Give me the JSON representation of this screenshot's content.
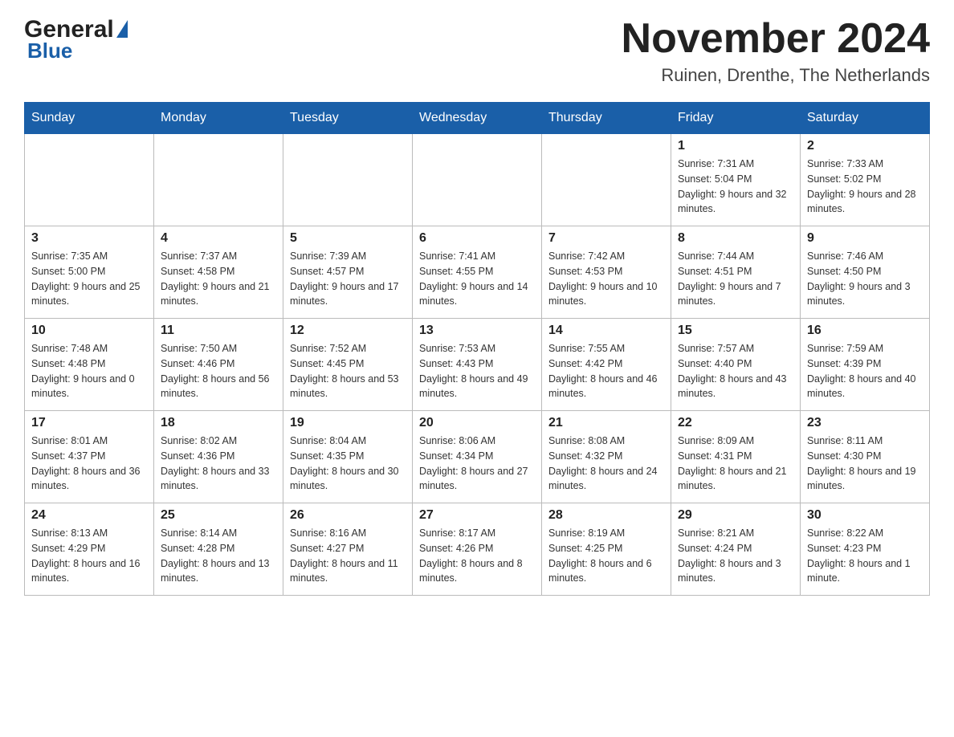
{
  "header": {
    "logo_general": "General",
    "logo_blue": "Blue",
    "month_title": "November 2024",
    "location": "Ruinen, Drenthe, The Netherlands"
  },
  "days_of_week": [
    "Sunday",
    "Monday",
    "Tuesday",
    "Wednesday",
    "Thursday",
    "Friday",
    "Saturday"
  ],
  "weeks": [
    [
      {
        "day": "",
        "info": ""
      },
      {
        "day": "",
        "info": ""
      },
      {
        "day": "",
        "info": ""
      },
      {
        "day": "",
        "info": ""
      },
      {
        "day": "",
        "info": ""
      },
      {
        "day": "1",
        "info": "Sunrise: 7:31 AM\nSunset: 5:04 PM\nDaylight: 9 hours and 32 minutes."
      },
      {
        "day": "2",
        "info": "Sunrise: 7:33 AM\nSunset: 5:02 PM\nDaylight: 9 hours and 28 minutes."
      }
    ],
    [
      {
        "day": "3",
        "info": "Sunrise: 7:35 AM\nSunset: 5:00 PM\nDaylight: 9 hours and 25 minutes."
      },
      {
        "day": "4",
        "info": "Sunrise: 7:37 AM\nSunset: 4:58 PM\nDaylight: 9 hours and 21 minutes."
      },
      {
        "day": "5",
        "info": "Sunrise: 7:39 AM\nSunset: 4:57 PM\nDaylight: 9 hours and 17 minutes."
      },
      {
        "day": "6",
        "info": "Sunrise: 7:41 AM\nSunset: 4:55 PM\nDaylight: 9 hours and 14 minutes."
      },
      {
        "day": "7",
        "info": "Sunrise: 7:42 AM\nSunset: 4:53 PM\nDaylight: 9 hours and 10 minutes."
      },
      {
        "day": "8",
        "info": "Sunrise: 7:44 AM\nSunset: 4:51 PM\nDaylight: 9 hours and 7 minutes."
      },
      {
        "day": "9",
        "info": "Sunrise: 7:46 AM\nSunset: 4:50 PM\nDaylight: 9 hours and 3 minutes."
      }
    ],
    [
      {
        "day": "10",
        "info": "Sunrise: 7:48 AM\nSunset: 4:48 PM\nDaylight: 9 hours and 0 minutes."
      },
      {
        "day": "11",
        "info": "Sunrise: 7:50 AM\nSunset: 4:46 PM\nDaylight: 8 hours and 56 minutes."
      },
      {
        "day": "12",
        "info": "Sunrise: 7:52 AM\nSunset: 4:45 PM\nDaylight: 8 hours and 53 minutes."
      },
      {
        "day": "13",
        "info": "Sunrise: 7:53 AM\nSunset: 4:43 PM\nDaylight: 8 hours and 49 minutes."
      },
      {
        "day": "14",
        "info": "Sunrise: 7:55 AM\nSunset: 4:42 PM\nDaylight: 8 hours and 46 minutes."
      },
      {
        "day": "15",
        "info": "Sunrise: 7:57 AM\nSunset: 4:40 PM\nDaylight: 8 hours and 43 minutes."
      },
      {
        "day": "16",
        "info": "Sunrise: 7:59 AM\nSunset: 4:39 PM\nDaylight: 8 hours and 40 minutes."
      }
    ],
    [
      {
        "day": "17",
        "info": "Sunrise: 8:01 AM\nSunset: 4:37 PM\nDaylight: 8 hours and 36 minutes."
      },
      {
        "day": "18",
        "info": "Sunrise: 8:02 AM\nSunset: 4:36 PM\nDaylight: 8 hours and 33 minutes."
      },
      {
        "day": "19",
        "info": "Sunrise: 8:04 AM\nSunset: 4:35 PM\nDaylight: 8 hours and 30 minutes."
      },
      {
        "day": "20",
        "info": "Sunrise: 8:06 AM\nSunset: 4:34 PM\nDaylight: 8 hours and 27 minutes."
      },
      {
        "day": "21",
        "info": "Sunrise: 8:08 AM\nSunset: 4:32 PM\nDaylight: 8 hours and 24 minutes."
      },
      {
        "day": "22",
        "info": "Sunrise: 8:09 AM\nSunset: 4:31 PM\nDaylight: 8 hours and 21 minutes."
      },
      {
        "day": "23",
        "info": "Sunrise: 8:11 AM\nSunset: 4:30 PM\nDaylight: 8 hours and 19 minutes."
      }
    ],
    [
      {
        "day": "24",
        "info": "Sunrise: 8:13 AM\nSunset: 4:29 PM\nDaylight: 8 hours and 16 minutes."
      },
      {
        "day": "25",
        "info": "Sunrise: 8:14 AM\nSunset: 4:28 PM\nDaylight: 8 hours and 13 minutes."
      },
      {
        "day": "26",
        "info": "Sunrise: 8:16 AM\nSunset: 4:27 PM\nDaylight: 8 hours and 11 minutes."
      },
      {
        "day": "27",
        "info": "Sunrise: 8:17 AM\nSunset: 4:26 PM\nDaylight: 8 hours and 8 minutes."
      },
      {
        "day": "28",
        "info": "Sunrise: 8:19 AM\nSunset: 4:25 PM\nDaylight: 8 hours and 6 minutes."
      },
      {
        "day": "29",
        "info": "Sunrise: 8:21 AM\nSunset: 4:24 PM\nDaylight: 8 hours and 3 minutes."
      },
      {
        "day": "30",
        "info": "Sunrise: 8:22 AM\nSunset: 4:23 PM\nDaylight: 8 hours and 1 minute."
      }
    ]
  ]
}
